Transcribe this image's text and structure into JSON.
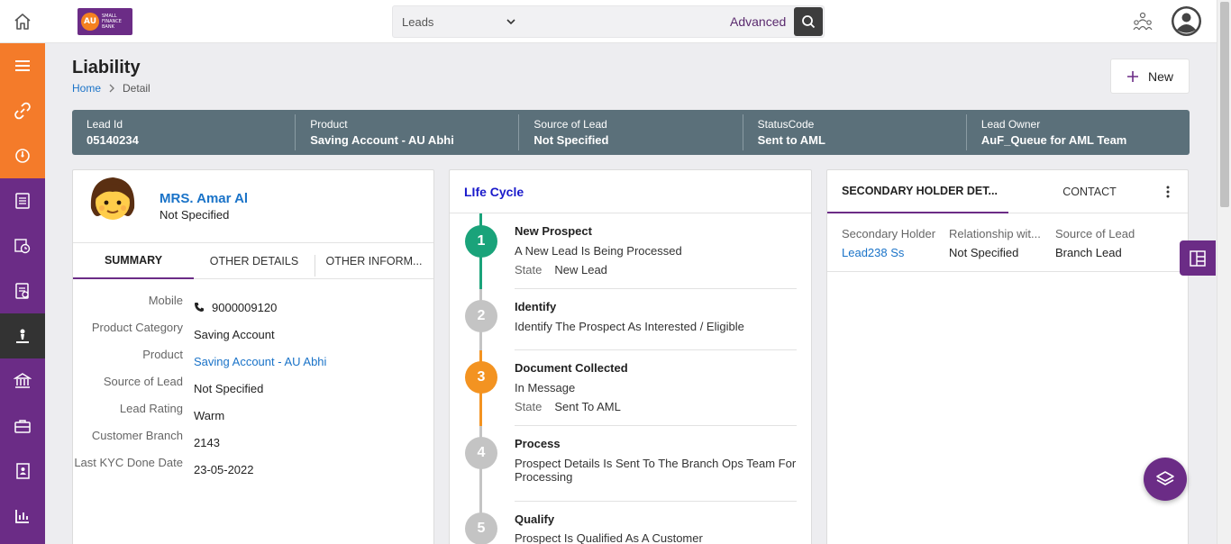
{
  "header": {
    "search_category": "Leads",
    "search_placeholder": "",
    "advanced_label": "Advanced"
  },
  "page": {
    "title": "Liability",
    "breadcrumb_home": "Home",
    "breadcrumb_current": "Detail",
    "new_button_label": "New"
  },
  "info_bar": [
    {
      "label": "Lead Id",
      "value": "05140234"
    },
    {
      "label": "Product",
      "value": "Saving Account - AU Abhi"
    },
    {
      "label": "Source of Lead",
      "value": "Not Specified"
    },
    {
      "label": "StatusCode",
      "value": "Sent to AML"
    },
    {
      "label": "Lead Owner",
      "value": "AuF_Queue for AML Team"
    }
  ],
  "customer": {
    "name": "MRS. Amar Al",
    "subtitle": "Not Specified",
    "tabs": [
      "SUMMARY",
      "OTHER DETAILS",
      "OTHER INFORM..."
    ],
    "fields": [
      {
        "label": "Mobile",
        "value": "9000009120"
      },
      {
        "label": "Product Category",
        "value": "Saving Account"
      },
      {
        "label": "Product",
        "value": "Saving Account - AU Abhi"
      },
      {
        "label": "Source of Lead",
        "value": "Not Specified"
      },
      {
        "label": "Lead Rating",
        "value": "Warm"
      },
      {
        "label": "Customer Branch",
        "value": "2143"
      },
      {
        "label": "Last KYC Done Date",
        "value": "23-05-2022"
      }
    ]
  },
  "lifecycle": {
    "title": "LIfe Cycle",
    "state_label": "State",
    "steps": [
      {
        "number": "1",
        "title": "New Prospect",
        "text": "A New Lead Is Being Processed",
        "state": "New Lead",
        "color": "#1aa37a"
      },
      {
        "number": "2",
        "title": "Identify",
        "text": "Identify The Prospect As Interested / Eligible",
        "state": "",
        "color": "#c4c4c4"
      },
      {
        "number": "3",
        "title": "Document Collected",
        "text": "In Message",
        "state": "Sent To AML",
        "color": "#f39321"
      },
      {
        "number": "4",
        "title": "Process",
        "text": "Prospect Details Is Sent To The Branch Ops Team For Processing",
        "state": "",
        "color": "#c4c4c4"
      },
      {
        "number": "5",
        "title": "Qualify",
        "text": "Prospect Is Qualified As A Customer",
        "state": "",
        "color": "#c4c4c4"
      }
    ]
  },
  "secondary": {
    "tab_active": "SECONDARY HOLDER DET...",
    "tab_contact": "CONTACT",
    "columns": [
      {
        "header": "Secondary Holder",
        "value": "Lead238 Ss"
      },
      {
        "header": "Relationship wit...",
        "value": "Not Specified"
      },
      {
        "header": "Source of Lead",
        "value": "Branch Lead"
      }
    ]
  },
  "colors": {
    "brand_purple": "#6b2c86",
    "brand_orange": "#f47b2a",
    "info_bar": "#5b707a",
    "link_blue": "#1a73c8"
  }
}
